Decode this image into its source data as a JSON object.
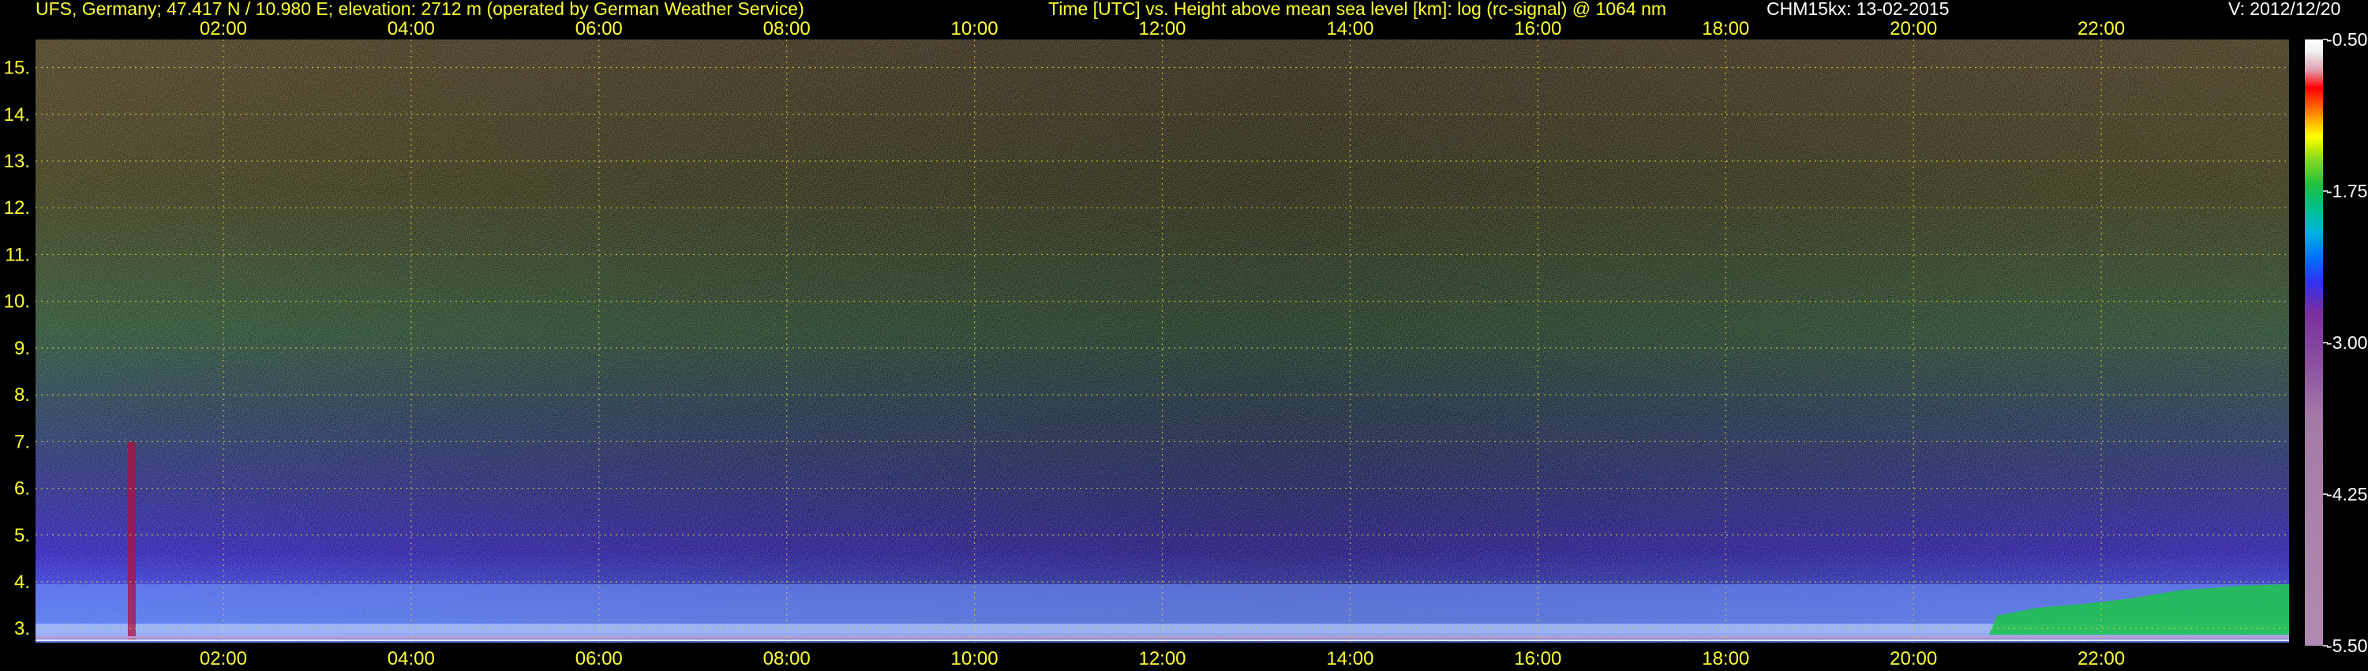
{
  "header": {
    "station": "UFS, Germany; 47.417 N / 10.980 E; elevation: 2712 m  (operated by German Weather Service)",
    "plot_title": "Time [UTC] vs. Height above mean sea level [km]: log (rc-signal) @ 1064 nm",
    "instrument": "CHM15kx: 13-02-2015",
    "version": "V: 2012/12/20"
  },
  "colors": {
    "background": "#000000",
    "axis_text": "#ffff33",
    "grid": "#d8d838",
    "header_white": "#ffffff"
  },
  "chart_data": {
    "type": "heatmap",
    "title": "Time [UTC] vs. Height above mean sea level [km]: log (rc-signal) @ 1064 nm",
    "x_ticks": [
      "02:00",
      "04:00",
      "06:00",
      "08:00",
      "10:00",
      "12:00",
      "14:00",
      "16:00",
      "18:00",
      "20:00",
      "22:00"
    ],
    "x_tick_hours": [
      2,
      4,
      6,
      8,
      10,
      12,
      14,
      16,
      18,
      20,
      22
    ],
    "xlim_hours": [
      0.0,
      24.0
    ],
    "y_ticks": [
      "3.",
      "4.",
      "5.",
      "6.",
      "7.",
      "8.",
      "9.",
      "10.",
      "11.",
      "12.",
      "13.",
      "14.",
      "15."
    ],
    "y_tick_values": [
      3,
      4,
      5,
      6,
      7,
      8,
      9,
      10,
      11,
      12,
      13,
      14,
      15
    ],
    "ylim_km": [
      2.7,
      15.6
    ],
    "grid": true,
    "colorbar": {
      "ticks": [
        "-0.50",
        "-1.75",
        "-3.00",
        "-4.25",
        "-5.50"
      ],
      "tick_values": [
        -0.5,
        -1.75,
        -3.0,
        -4.25,
        -5.5
      ],
      "range": [
        -5.5,
        -0.5
      ],
      "colors_low_to_high": [
        "#b08ab0",
        "#a47aa6",
        "#8c52a0",
        "#7a2ea0",
        "#3030f0",
        "#0070ff",
        "#00b0e0",
        "#00c090",
        "#20c040",
        "#80d820",
        "#ffff00",
        "#ffa000",
        "#ff4000",
        "#ff0000",
        "#e0a0b0",
        "#f0f0f0",
        "#ffffff"
      ]
    }
  }
}
